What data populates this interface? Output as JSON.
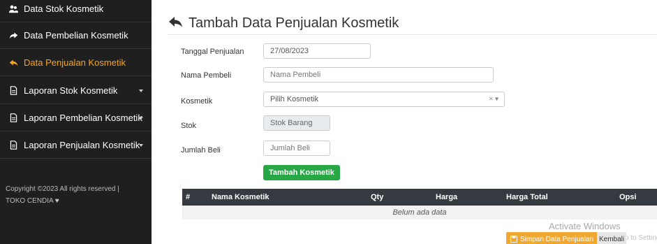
{
  "sidebar": {
    "items": [
      {
        "label": "Data Stok Kosmetik",
        "icon": "users-icon",
        "active": false,
        "dropdown": false
      },
      {
        "label": "Data Pembelian Kosmetik",
        "icon": "share-icon",
        "active": false,
        "dropdown": false
      },
      {
        "label": "Data Penjualan Kosmetik",
        "icon": "reply-icon",
        "active": true,
        "dropdown": false
      },
      {
        "label": "Laporan Stok Kosmetik",
        "icon": "file-icon",
        "active": false,
        "dropdown": true
      },
      {
        "label": "Laporan Pembelian Kosmetik",
        "icon": "file-icon",
        "active": false,
        "dropdown": true
      },
      {
        "label": "Laporan Penjualan Kosmetik",
        "icon": "file-icon",
        "active": false,
        "dropdown": true
      }
    ],
    "copyright_line1": "Copyright ©2023 All rights reserved |",
    "copyright_line2": "TOKO CENDIA",
    "heart_glyph": "♥"
  },
  "page": {
    "title": "Tambah Data Penjualan Kosmetik",
    "title_icon": "reply-icon"
  },
  "form": {
    "tanggal": {
      "label": "Tanggal Penjualan",
      "value": "27/08/2023"
    },
    "nama": {
      "label": "Nama Pembeli",
      "placeholder": "Nama Pembeli"
    },
    "kosmetik": {
      "label": "Kosmetik",
      "placeholder": "Pilih Kosmetik",
      "clear": "×",
      "arrow": "▾"
    },
    "stok": {
      "label": "Stok",
      "placeholder": "Stok Barang"
    },
    "jumlah": {
      "label": "Jumlah Beli",
      "placeholder": "Jumlah Beli"
    },
    "add_button": "Tambah Kosmetik"
  },
  "table": {
    "columns": [
      "#",
      "Nama Kosmetik",
      "Qty",
      "Harga",
      "Harga Total",
      "Opsi"
    ],
    "empty_text": "Belum ada data"
  },
  "footer": {
    "save_label": "Simpan Data Penjualan",
    "back_label": "Kembali"
  },
  "watermark": {
    "line1": "Activate Windows",
    "line2": "Go to Settings to activate Windows."
  },
  "colors": {
    "sidebar_bg": "#1f1f1f",
    "active": "#f5a623",
    "success": "#28a745",
    "warning": "#f0a830",
    "table_head": "#343a40"
  }
}
